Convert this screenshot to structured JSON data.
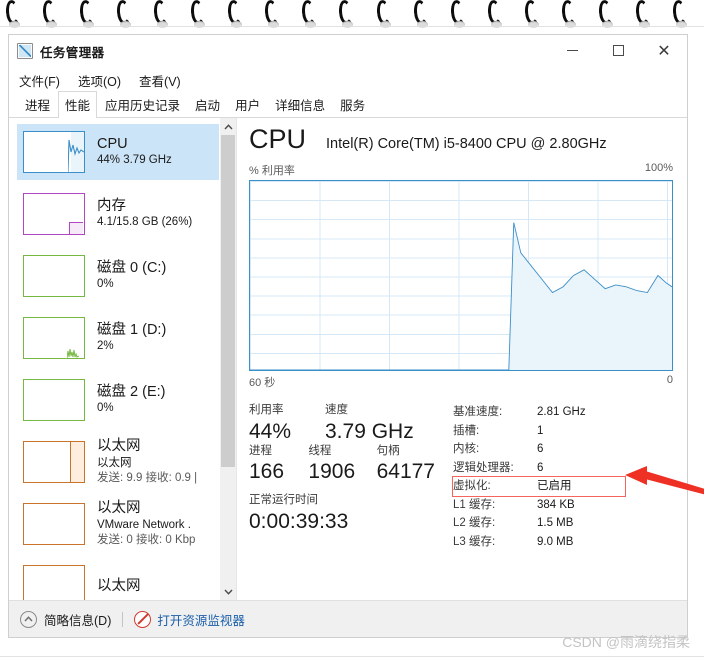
{
  "window": {
    "title": "任务管理器",
    "app_icon": "chart-app-icon",
    "controls": {
      "minimize": "–",
      "maximize": "□",
      "close": "✕"
    }
  },
  "menu": {
    "items": [
      "文件(F)",
      "选项(O)",
      "查看(V)"
    ]
  },
  "tabs": {
    "active_index": 1,
    "items": [
      "进程",
      "性能",
      "应用历史记录",
      "启动",
      "用户",
      "详细信息",
      "服务"
    ]
  },
  "sidebar": {
    "items": [
      {
        "kind": "cpu",
        "title": "CPU",
        "sub1": "44% 3.79 GHz",
        "sub2": "",
        "selected": true,
        "color": "#3b8fc9"
      },
      {
        "kind": "mem",
        "title": "内存",
        "sub1": "4.1/15.8 GB (26%)",
        "sub2": "",
        "selected": false,
        "color": "#b146c2"
      },
      {
        "kind": "disk",
        "title": "磁盘 0 (C:)",
        "sub1": "0%",
        "sub2": "",
        "selected": false,
        "color": "#77b843"
      },
      {
        "kind": "disk",
        "title": "磁盘 1 (D:)",
        "sub1": "2%",
        "sub2": "",
        "selected": false,
        "color": "#77b843"
      },
      {
        "kind": "disk",
        "title": "磁盘 2 (E:)",
        "sub1": "0%",
        "sub2": "",
        "selected": false,
        "color": "#77b843"
      },
      {
        "kind": "net",
        "title": "以太网",
        "sub1": "以太网",
        "sub2": "发送: 9.9 接收: 0.9 |",
        "selected": false,
        "color": "#c9732b"
      },
      {
        "kind": "net",
        "title": "以太网",
        "sub1": "VMware Network .",
        "sub2": "发送: 0 接收: 0 Kbp",
        "selected": false,
        "color": "#c9732b"
      },
      {
        "kind": "net",
        "title": "以太网",
        "sub1": "",
        "sub2": "",
        "selected": false,
        "color": "#c9732b"
      }
    ],
    "scrollbar": {
      "up": "⌃",
      "down": "⌄",
      "thumb_percent": 74
    }
  },
  "detail": {
    "heading": "CPU",
    "model": "Intel(R) Core(TM) i5-8400 CPU @ 2.80GHz",
    "axis_label_left": "% 利用率",
    "axis_label_right": "100%",
    "time_label_left": "60 秒",
    "time_label_right": "0",
    "stats_left": [
      {
        "label": "利用率",
        "value": "44%"
      },
      {
        "label": "速度",
        "value": "3.79 GHz"
      },
      {
        "label": "进程",
        "value": "166"
      },
      {
        "label": "线程",
        "value": "1906"
      },
      {
        "label": "句柄",
        "value": "64177"
      }
    ],
    "uptime": {
      "label": "正常运行时间",
      "value": "0:00:39:33"
    },
    "specs": [
      {
        "key": "基准速度:",
        "value": "2.81 GHz",
        "highlight": false
      },
      {
        "key": "插槽:",
        "value": "1",
        "highlight": false
      },
      {
        "key": "内核:",
        "value": "6",
        "highlight": false
      },
      {
        "key": "逻辑处理器:",
        "value": "6",
        "highlight": false
      },
      {
        "key": "虚拟化:",
        "value": "已启用",
        "highlight": true
      },
      {
        "key": "L1 缓存:",
        "value": "384 KB",
        "highlight": false
      },
      {
        "key": "L2 缓存:",
        "value": "1.5 MB",
        "highlight": false
      },
      {
        "key": "L3 缓存:",
        "value": "9.0 MB",
        "highlight": false
      }
    ],
    "annotation_color": "#ee3124"
  },
  "statusbar": {
    "collapse_icon": "chevron-up-icon",
    "collapse_label": "简略信息(D)",
    "monitor_icon": "no-entry-icon",
    "monitor_link": "打开资源监视器"
  },
  "watermark": "CSDN @雨滴绕指柔",
  "chart_data": {
    "type": "area",
    "title": "% 利用率",
    "xlabel": "60 秒",
    "ylabel": "% 利用率",
    "xlim": [
      60,
      0
    ],
    "ylim": [
      0,
      100
    ],
    "grid": true,
    "legend": "none",
    "line_color": "#3b8fc9",
    "fill_color": "#eaf4fb",
    "x": [
      60,
      54,
      48,
      42,
      36,
      30,
      24,
      23.2,
      22.5,
      21.5,
      20,
      18.5,
      17,
      15.5,
      14,
      12.5,
      11,
      9.5,
      8,
      6.5,
      5,
      3.5,
      2,
      0.8,
      0
    ],
    "values": [
      0,
      0,
      0,
      0,
      0,
      0,
      0,
      0,
      78,
      62,
      55,
      48,
      41,
      44,
      50,
      53,
      48,
      43,
      45,
      44,
      42,
      41,
      50,
      46,
      44
    ]
  }
}
